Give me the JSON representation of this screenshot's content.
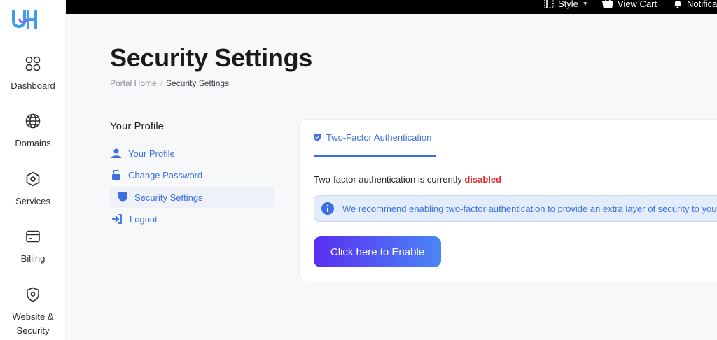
{
  "sidebar": {
    "logo_text": "UH",
    "items": [
      {
        "label": "Dashboard",
        "icon": "grid-icon"
      },
      {
        "label": "Domains",
        "icon": "globe-icon"
      },
      {
        "label": "Services",
        "icon": "hexagon-icon"
      },
      {
        "label": "Billing",
        "icon": "card-icon"
      },
      {
        "label": "Website & Security",
        "icon": "shield-icon"
      }
    ]
  },
  "topbar": {
    "style_label": "Style",
    "cart_label": "View Cart",
    "notifications_label": "Notifications"
  },
  "page": {
    "title": "Security Settings",
    "breadcrumb": {
      "home": "Portal Home",
      "separator": "/",
      "current": "Security Settings"
    }
  },
  "profile_menu": {
    "heading": "Your Profile",
    "links": [
      {
        "label": "Your Profile",
        "icon": "user-icon"
      },
      {
        "label": "Change Password",
        "icon": "unlock-icon"
      },
      {
        "label": "Security Settings",
        "icon": "shield-icon",
        "active": true
      },
      {
        "label": "Logout",
        "icon": "logout-icon"
      }
    ]
  },
  "card": {
    "tab_label": "Two-Factor Authentication",
    "status_text": "Two-factor authentication is currently",
    "status_value": "disabled",
    "alert_text": "We recommend enabling two-factor authentication to provide an extra layer of security to your account.",
    "button_label": "Click here to Enable"
  },
  "colors": {
    "accent": "#3d6fe0",
    "danger": "#e3262c",
    "button_gradient_start": "#5a2ef0",
    "button_gradient_end": "#4a86f5",
    "topbar": "#000000"
  }
}
